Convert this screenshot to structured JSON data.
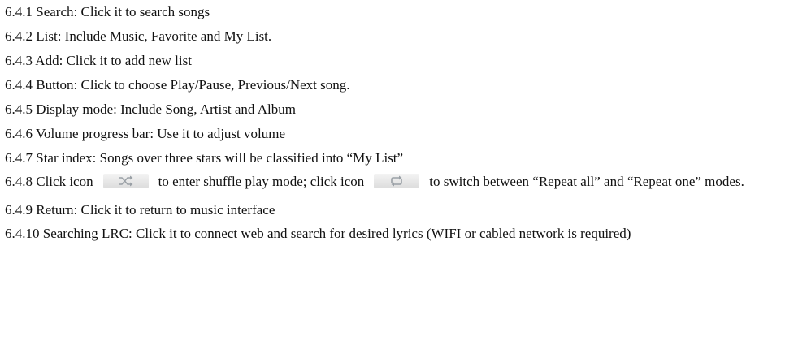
{
  "lines": [
    "6.4.1 Search: Click it to search songs",
    "6.4.2 List: Include Music, Favorite and My List.",
    "6.4.3 Add: Click it to add new list",
    "6.4.4 Button: Click to choose Play/Pause, Previous/Next song.",
    "6.4.5 Display mode: Include Song, Artist and Album",
    "6.4.6 Volume progress bar: Use it to adjust volume",
    "6.4.7 Star index: Songs over three stars will be classified into “My List”"
  ],
  "item_648": {
    "part1": "6.4.8 Click icon",
    "part2": "to enter shuffle play mode; click icon",
    "part3": "to switch between “Repeat all” and “Repeat one” modes.",
    "shuffle_icon": "shuffle-icon",
    "repeat_icon": "repeat-icon"
  },
  "line_649": "6.4.9 Return: Click it to return to music interface",
  "line_6410": "6.4.10 Searching LRC: Click it to connect web and search for desired lyrics (WIFI or cabled network is required)"
}
